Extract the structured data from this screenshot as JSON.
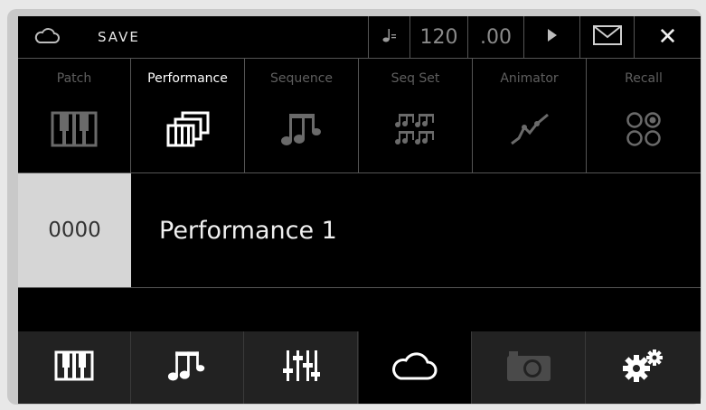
{
  "topbar": {
    "cloud_icon": "cloud-icon",
    "save_label": "SAVE",
    "note_icon": "quarter-note-tempo-icon",
    "tempo_whole": "120",
    "tempo_fraction": ".00",
    "play_icon": "play-icon",
    "mail_icon": "mail-icon",
    "close_label": "✕"
  },
  "modes": [
    {
      "label": "Patch",
      "icon": "keyboard-icon",
      "active": false
    },
    {
      "label": "Performance",
      "icon": "stacked-keyboards-icon",
      "active": true
    },
    {
      "label": "Sequence",
      "icon": "music-notes-icon",
      "active": false
    },
    {
      "label": "Seq Set",
      "icon": "sequence-set-icon",
      "active": false
    },
    {
      "label": "Animator",
      "icon": "animator-curve-icon",
      "active": false
    },
    {
      "label": "Recall",
      "icon": "recall-circles-icon",
      "active": false
    }
  ],
  "current": {
    "number": "0000",
    "name": "Performance 1"
  },
  "bottom": [
    {
      "icon": "keyboard-icon",
      "active": false
    },
    {
      "icon": "music-notes-icon",
      "active": false
    },
    {
      "icon": "mixer-sliders-icon",
      "active": false
    },
    {
      "icon": "cloud-icon",
      "active": true
    },
    {
      "icon": "camera-icon",
      "active": false,
      "disabled": true
    },
    {
      "icon": "settings-gears-icon",
      "active": false
    }
  ],
  "colors": {
    "background": "#000000",
    "number_bg": "#d6d6d6",
    "inactive_label": "#5f5f5f",
    "active_label": "#ffffff",
    "icon": "#ffffff",
    "disabled_icon": "#4a4a4a"
  }
}
